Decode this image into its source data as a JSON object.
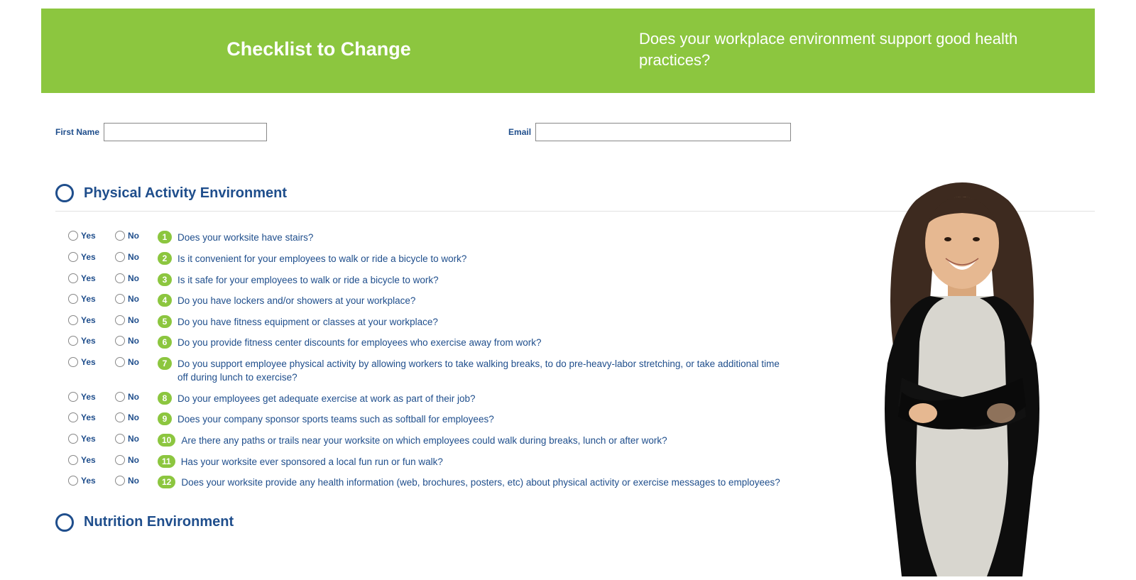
{
  "header": {
    "title": "Checklist to Change",
    "subtitle": "Does your workplace environment support good health practices?"
  },
  "fields": {
    "first_name_label": "First Name",
    "first_name_value": "",
    "email_label": "Email",
    "email_value": ""
  },
  "labels": {
    "yes": "Yes",
    "no": "No"
  },
  "section1": {
    "title": "Physical Activity Environment",
    "questions": [
      {
        "num": "1",
        "text": "Does your worksite have stairs?"
      },
      {
        "num": "2",
        "text": "Is it convenient for your employees to walk or ride a bicycle to work?"
      },
      {
        "num": "3",
        "text": "Is it safe for your employees to walk or ride a bicycle to work?"
      },
      {
        "num": "4",
        "text": "Do you have lockers and/or showers at your workplace?"
      },
      {
        "num": "5",
        "text": "Do you have fitness equipment or classes at your workplace?"
      },
      {
        "num": "6",
        "text": "Do you provide fitness center discounts for employees who exercise away from work?"
      },
      {
        "num": "7",
        "text": "Do you support employee physical activity by allowing workers to take walking breaks, to do pre-heavy-labor stretching, or take additional time off during lunch to exercise?"
      },
      {
        "num": "8",
        "text": "Do your employees get adequate exercise at work as part of their job?"
      },
      {
        "num": "9",
        "text": "Does your company sponsor sports teams such as softball for employees?"
      },
      {
        "num": "10",
        "text": "Are there any paths or trails near your worksite on which employees could walk during breaks, lunch or after work?"
      },
      {
        "num": "11",
        "text": "Has your worksite ever sponsored a local fun run or fun walk?"
      },
      {
        "num": "12",
        "text": "Does your worksite provide any health information (web, brochures, posters, etc) about physical activity or exercise messages to employees?"
      }
    ]
  },
  "section2": {
    "title": "Nutrition Environment"
  }
}
